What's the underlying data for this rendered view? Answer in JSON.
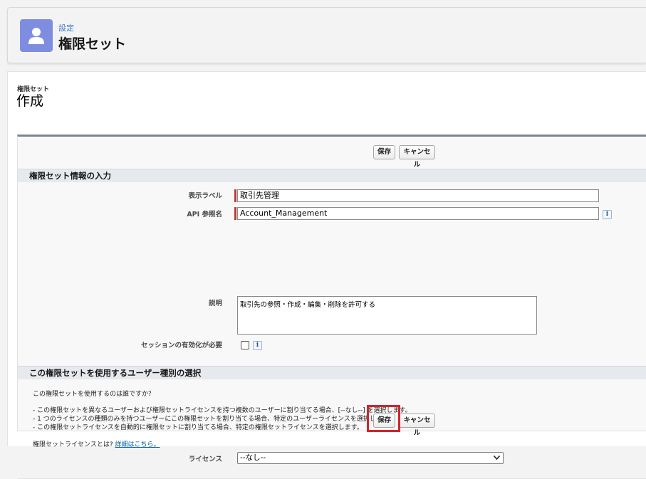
{
  "header": {
    "eyebrow": "設定",
    "title": "権限セット",
    "icon": "user-icon",
    "icon_color": "#7f8de1"
  },
  "page": {
    "eyebrow": "権限セット",
    "title": "作成"
  },
  "toolbar": {
    "save_label": "保存",
    "cancel_label": "キャンセル"
  },
  "section_info": {
    "title": "権限セット情報の入力",
    "fields": {
      "label": {
        "label": "表示ラベル",
        "value": "取引先管理"
      },
      "api_name": {
        "label": "API 参照名",
        "value": "Account_Management",
        "info": "i"
      },
      "description": {
        "label": "説明",
        "value": "取引先の参照・作成・編集・削除を許可する"
      },
      "session": {
        "label": "セッションの有効化が必要",
        "checked": false,
        "info": "i"
      }
    }
  },
  "section_license": {
    "title": "この権限セットを使用するユーザー種別の選択",
    "question": "この権限セットを使用するのは誰ですか?",
    "bullets": [
      "- この権限セットを異なるユーザーおよび権限セットライセンスを持つ複数のユーザーに割り当てる場合、[--なし--] を選択します。",
      "- 1 つのライセンスの種類のみを持つユーザーにこの権限セットを割り当てる場合、特定のユーザーライセンスを選択します。",
      "- この権限セットライセンスを自動的に権限セットに割り当てる場合、特定の権限セットライセンスを選択します。"
    ],
    "license_question": "権限セットライセンスとは?",
    "license_link": "詳細はこちら。",
    "license_field_label": "ライセンス",
    "license_value": "--なし--"
  },
  "colors": {
    "required": "#c23934",
    "highlight": "#d2232a",
    "link": "#015ba7"
  }
}
